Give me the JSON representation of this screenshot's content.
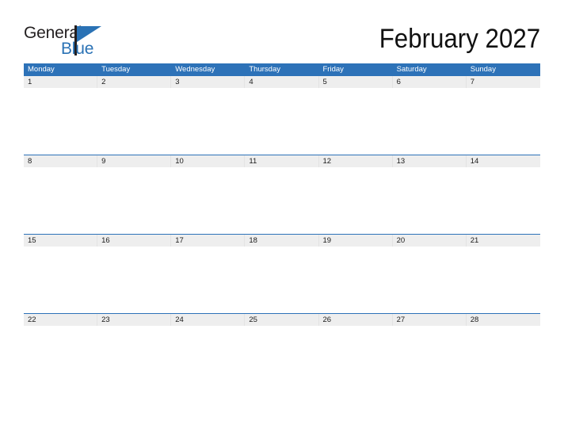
{
  "brand": {
    "name_part1": "General",
    "name_part2": "Blue",
    "mark": "flag-triangle",
    "color_dark": "#231f20",
    "color_blue": "#2a72b5"
  },
  "header": {
    "title": "February 2027",
    "month": "February",
    "year": "2027"
  },
  "theme": {
    "header_blue": "#2d72b8",
    "date_row_gray": "#eeeeee",
    "page_background": "#ffffff",
    "text_dark": "#1a1a1a",
    "header_text": "#ffffff"
  },
  "calendar": {
    "week_start": "Monday",
    "day_headers": [
      "Monday",
      "Tuesday",
      "Wednesday",
      "Thursday",
      "Friday",
      "Saturday",
      "Sunday"
    ],
    "weeks": [
      {
        "dates": [
          "1",
          "2",
          "3",
          "4",
          "5",
          "6",
          "7"
        ]
      },
      {
        "dates": [
          "8",
          "9",
          "10",
          "11",
          "12",
          "13",
          "14"
        ]
      },
      {
        "dates": [
          "15",
          "16",
          "17",
          "18",
          "19",
          "20",
          "21"
        ]
      },
      {
        "dates": [
          "22",
          "23",
          "24",
          "25",
          "26",
          "27",
          "28"
        ]
      }
    ]
  }
}
